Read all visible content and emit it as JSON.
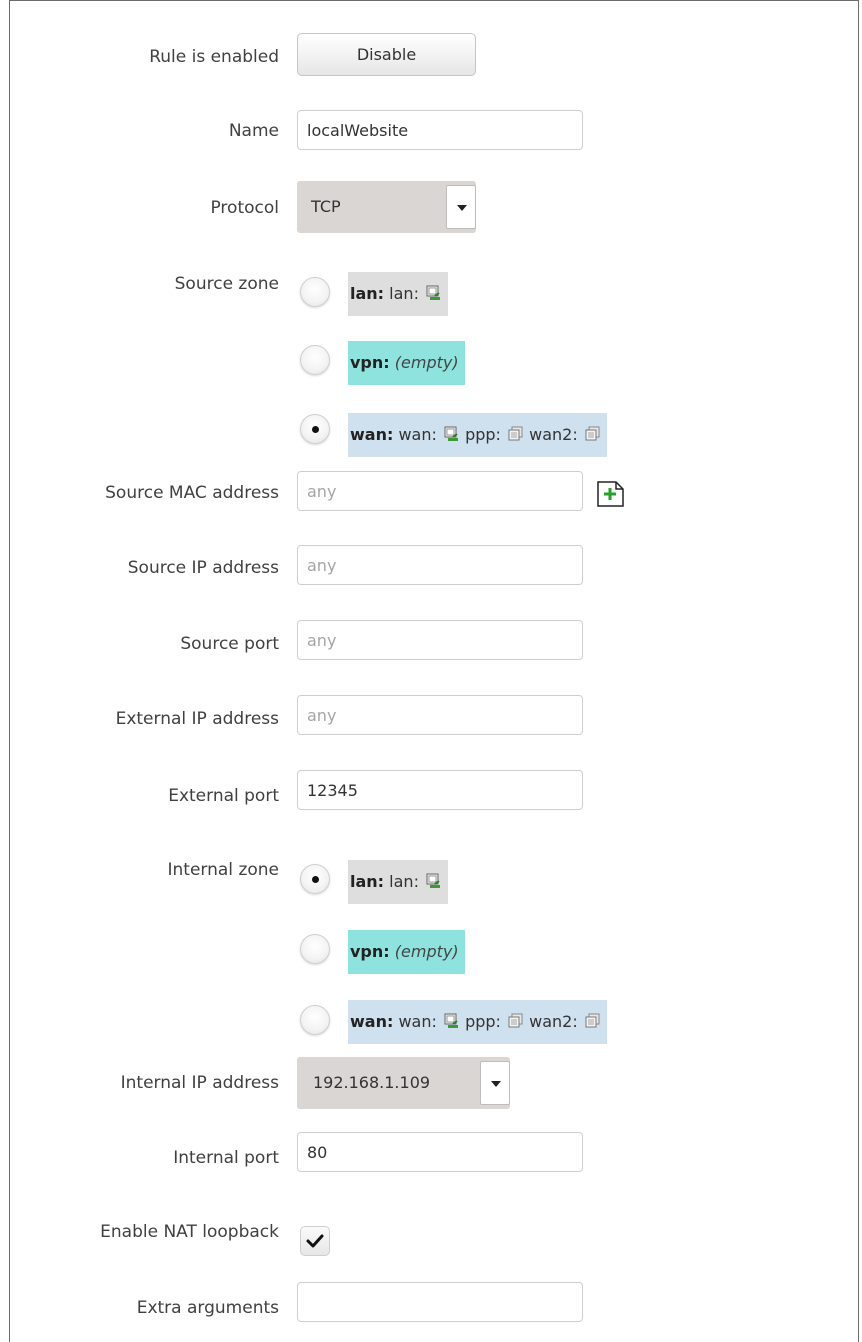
{
  "form": {
    "rule_enabled": {
      "label": "Rule is enabled",
      "button": "Disable"
    },
    "name": {
      "label": "Name",
      "value": "localWebsite"
    },
    "protocol": {
      "label": "Protocol",
      "value": "TCP"
    },
    "source_zone": {
      "label": "Source zone",
      "options": [
        {
          "zone": "lan:",
          "detail": "lan:",
          "checked": false,
          "bg": "#dedede"
        },
        {
          "zone": "vpn:",
          "detail": "(empty)",
          "checked": false,
          "bg": "#8fe3df"
        },
        {
          "zone": "wan:",
          "detail": "wan:",
          "extra1": "ppp:",
          "extra2": "wan2:",
          "checked": true,
          "bg": "#cfe0ee"
        }
      ]
    },
    "source_mac": {
      "label": "Source MAC address",
      "placeholder": "any"
    },
    "source_ip": {
      "label": "Source IP address",
      "placeholder": "any"
    },
    "source_port": {
      "label": "Source port",
      "placeholder": "any"
    },
    "external_ip": {
      "label": "External IP address",
      "placeholder": "any"
    },
    "external_port": {
      "label": "External port",
      "value": "12345"
    },
    "internal_zone": {
      "label": "Internal zone",
      "options": [
        {
          "zone": "lan:",
          "detail": "lan:",
          "checked": true,
          "bg": "#dedede"
        },
        {
          "zone": "vpn:",
          "detail": "(empty)",
          "checked": false,
          "bg": "#8fe3df"
        },
        {
          "zone": "wan:",
          "detail": "wan:",
          "extra1": "ppp:",
          "extra2": "wan2:",
          "checked": false,
          "bg": "#cfe0ee"
        }
      ]
    },
    "internal_ip": {
      "label": "Internal IP address",
      "value": "192.168.1.109"
    },
    "internal_port": {
      "label": "Internal port",
      "value": "80"
    },
    "nat_loopback": {
      "label": "Enable NAT loopback",
      "checked": true
    },
    "extra_args": {
      "label": "Extra arguments",
      "value": ""
    }
  }
}
